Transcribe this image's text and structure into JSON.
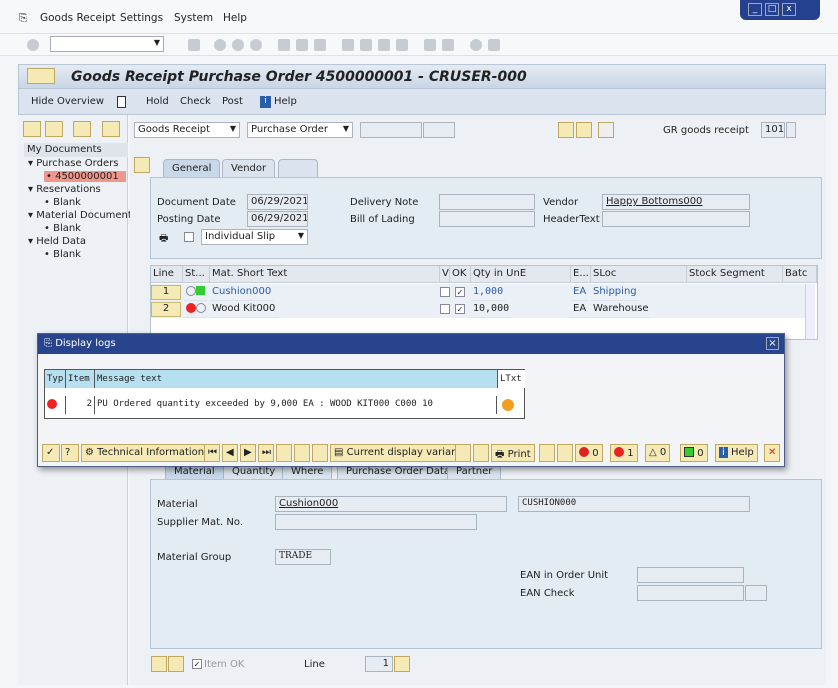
{
  "menu": {
    "items": [
      "Goods Receipt",
      "Settings",
      "System",
      "Help"
    ]
  },
  "window_controls": {
    "minimize": "_",
    "maximize": "□",
    "close": "x"
  },
  "title": "Goods Receipt Purchase Order 4500000001 - CRUSER-000",
  "app_toolbar": {
    "hide_overview": "Hide Overview",
    "hold": "Hold",
    "check": "Check",
    "post": "Post",
    "help": "Help"
  },
  "sidebar": {
    "header": "My Documents",
    "tree": [
      {
        "label": "Purchase Orders",
        "children": [
          "4500000001"
        ]
      },
      {
        "label": "Reservations",
        "children": [
          "Blank"
        ]
      },
      {
        "label": "Material Documents",
        "children": [
          "Blank"
        ]
      },
      {
        "label": "Held Data",
        "children": [
          "Blank"
        ]
      }
    ]
  },
  "header_bar": {
    "transaction": "Goods Receipt",
    "reference": "Purchase Order",
    "gr_label": "GR goods receipt",
    "movement_type": "101"
  },
  "header_tabs": [
    "General",
    "Vendor"
  ],
  "general": {
    "document_date_label": "Document Date",
    "document_date": "06/29/2021",
    "posting_date_label": "Posting Date",
    "posting_date": "06/29/2021",
    "delivery_note_label": "Delivery Note",
    "bill_of_lading_label": "Bill of Lading",
    "vendor_label": "Vendor",
    "vendor": "Happy Bottoms000",
    "header_text_label": "HeaderText",
    "slip": "Individual Slip"
  },
  "items_table": {
    "columns": [
      "Line",
      "St...",
      "Mat. Short Text",
      "V",
      "OK",
      "Qty in UnE",
      "E...",
      "SLoc",
      "Stock Segment",
      "Batc"
    ],
    "rows": [
      {
        "line": "1",
        "text": "Cushion000",
        "ok": true,
        "qty": "1,000",
        "unit": "EA",
        "sloc": "Shipping",
        "status": "green"
      },
      {
        "line": "2",
        "text": "Wood Kit000",
        "ok": true,
        "qty": "10,000",
        "unit": "EA",
        "sloc": "Warehouse",
        "status": "red"
      }
    ]
  },
  "dialog": {
    "title": "Display logs",
    "columns": [
      "Typ",
      "Item",
      "Message text",
      "LTxt"
    ],
    "rows": [
      {
        "type": "error",
        "item": "2",
        "message": "PU Ordered quantity exceeded by 9,000 EA : WOOD KIT000 C000 10"
      }
    ],
    "buttons": {
      "technical_information": "Technical Information",
      "current_display_variant": "Current display variant",
      "print": "Print",
      "help": "Help",
      "stop_count": "0",
      "error_count": "1",
      "warning_count": "0",
      "success_count": "0"
    }
  },
  "item_tabs": [
    "Material",
    "Quantity",
    "Where",
    "Purchase Order Data",
    "Partner"
  ],
  "material": {
    "material_label": "Material",
    "material": "Cushion000",
    "material_desc": "CUSHION000",
    "supplier_mat_label": "Supplier Mat. No.",
    "material_group_label": "Material Group",
    "material_group": "TRADE",
    "ean_order_unit_label": "EAN in Order Unit",
    "ean_check_label": "EAN Check"
  },
  "footer": {
    "item_ok": "Item OK",
    "line_label": "Line",
    "line_value": "1"
  },
  "colors": {
    "title_bar": "#27448c",
    "selected_doc": "#f0968a",
    "button_yellow": "#f5e9b5"
  }
}
